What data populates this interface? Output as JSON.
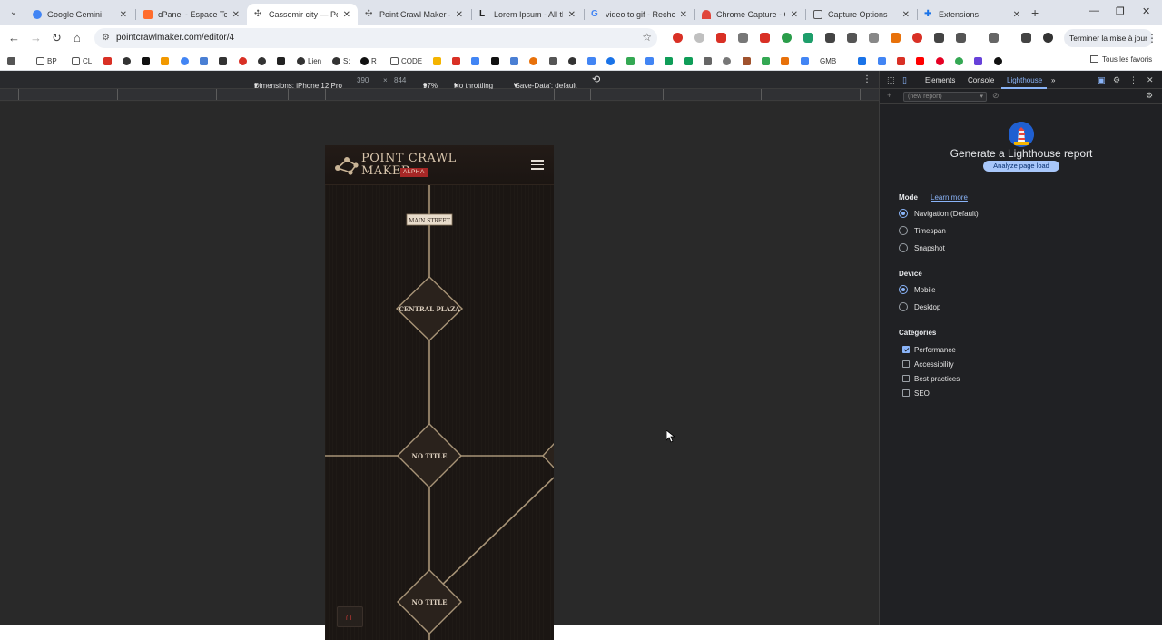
{
  "browser": {
    "tabs": [
      {
        "label": "Google Gemini",
        "color": "#4285f4",
        "active": false
      },
      {
        "label": "cPanel - Espace Tech",
        "color": "#ff6c2c",
        "active": false
      },
      {
        "label": "Cassomir city — Poin",
        "color": "#555555",
        "active": true
      },
      {
        "label": "Point Crawl Maker —",
        "color": "#555555",
        "active": false
      },
      {
        "label": "Lorem Ipsum - All th",
        "color": "#222222",
        "active": false
      },
      {
        "label": "video to gif - Recher",
        "color": "#4285f4",
        "active": false
      },
      {
        "label": "Chrome Capture - Ca",
        "color": "#e0463a",
        "active": false
      },
      {
        "label": "Capture Options",
        "color": "#555555",
        "active": false
      },
      {
        "label": "Extensions",
        "color": "#1a73e8",
        "active": false
      }
    ],
    "new_tab": "+",
    "window_controls": {
      "minimize": "—",
      "restore": "❐",
      "close": "✕"
    },
    "url": "pointcrawlmaker.com/editor/4",
    "update_button": "Terminer la mise à jour",
    "bookmarks": [
      {
        "label": "BP",
        "color": "#555555"
      },
      {
        "label": "CL",
        "color": "#555555"
      },
      {
        "label": "Lien",
        "color": "#333333"
      },
      {
        "label": "S:",
        "color": "#333333"
      },
      {
        "label": "R",
        "color": "#111111"
      },
      {
        "label": "CODE",
        "color": "#555555"
      },
      {
        "label": "GMB",
        "color": "#4285f4"
      }
    ],
    "all_bookmarks": "Tous les favoris"
  },
  "devbar": {
    "dimensions_label": "Dimensions: iPhone 12 Pro",
    "width": "390",
    "times": "×",
    "height": "844",
    "zoom": "97%",
    "throttling": "No throttling",
    "save_data": "'Save-Data': default"
  },
  "app": {
    "logo_line1": "POINT CRAWL",
    "logo_line2": "MAKER",
    "alpha_badge": "ALPHA",
    "nodes": {
      "main_street": "MAIN STREET",
      "central_plaza": "CENTRAL PLAZA",
      "no_title_1": "NO TITLE",
      "no_title_2": "NO TITLE"
    },
    "fab_icon": "magnet-icon"
  },
  "devtools": {
    "tabs": {
      "elements": "Elements",
      "console": "Console",
      "lighthouse": "Lighthouse",
      "more": "»"
    },
    "report_select": "(new report)",
    "title": "Generate a Lighthouse report",
    "analyze_button": "Analyze page load",
    "mode": {
      "heading": "Mode",
      "learn_more": "Learn more",
      "options": [
        "Navigation (Default)",
        "Timespan",
        "Snapshot"
      ],
      "selected": "Navigation (Default)"
    },
    "device": {
      "heading": "Device",
      "options": [
        "Mobile",
        "Desktop"
      ],
      "selected": "Mobile"
    },
    "categories": {
      "heading": "Categories",
      "items": [
        {
          "label": "Performance",
          "checked": true
        },
        {
          "label": "Accessibility",
          "checked": false
        },
        {
          "label": "Best practices",
          "checked": false
        },
        {
          "label": "SEO",
          "checked": false
        }
      ]
    }
  }
}
